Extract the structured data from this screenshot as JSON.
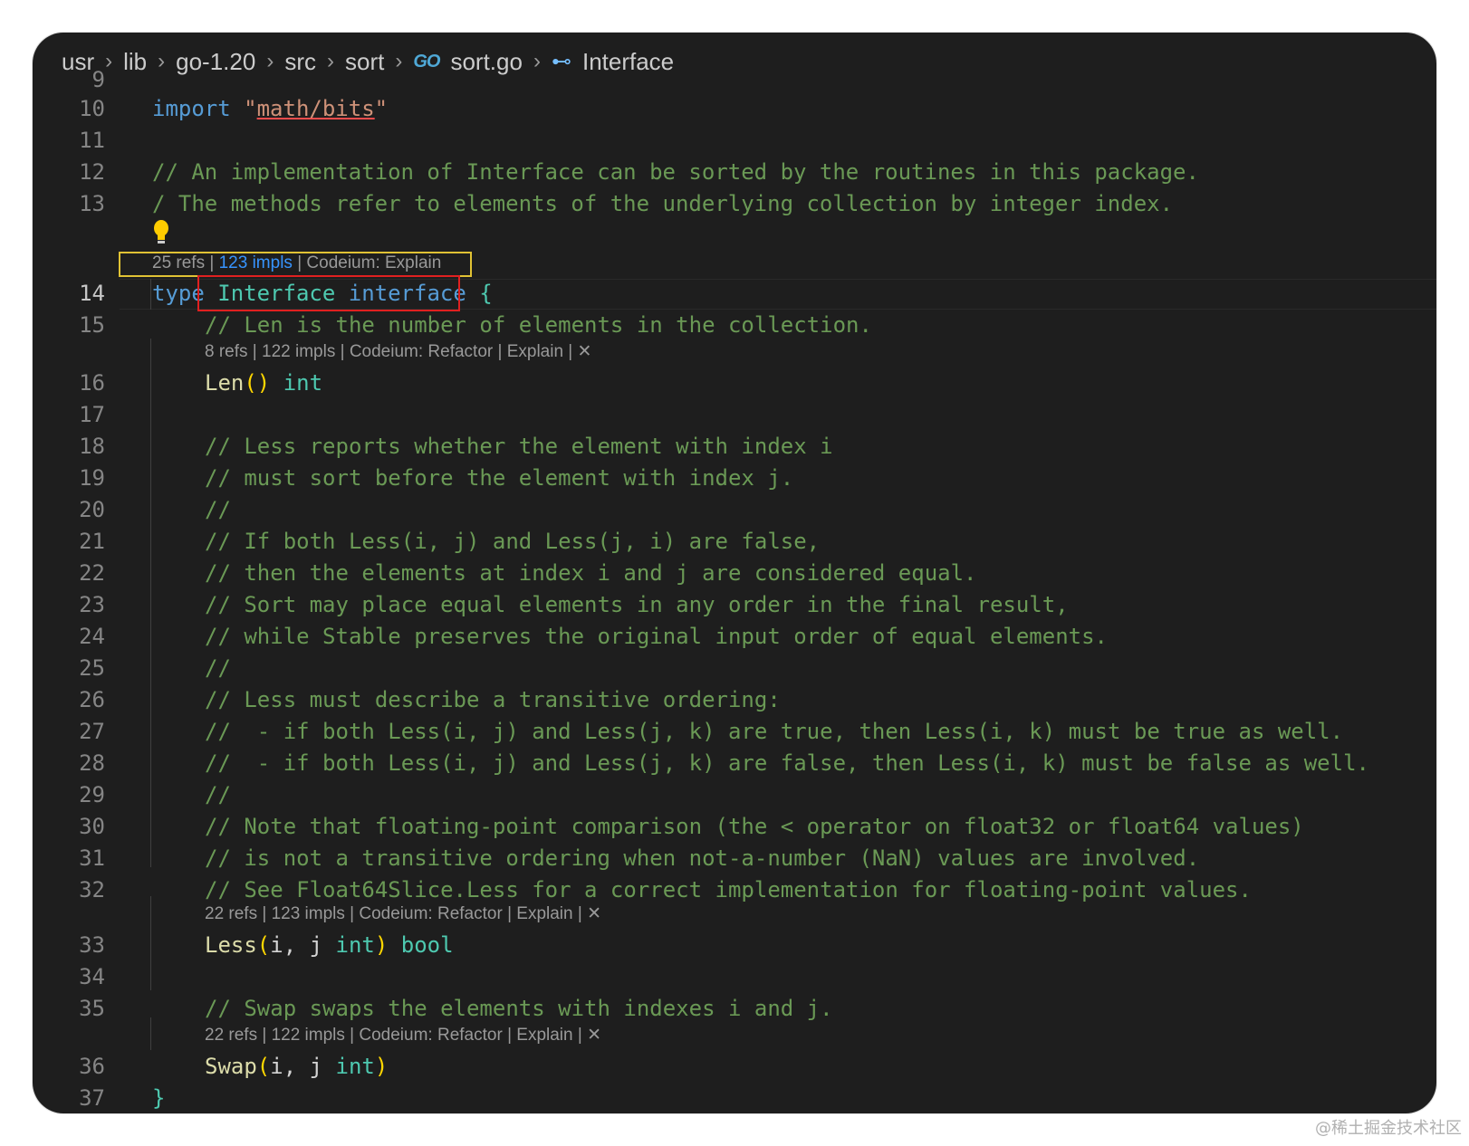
{
  "breadcrumb": {
    "items": [
      "usr",
      "lib",
      "go-1.20",
      "src",
      "sort",
      "sort.go",
      "Interface"
    ],
    "go_icon": "GO",
    "separator": ">"
  },
  "lenses": {
    "l14": "25 refs | ",
    "l14_link": "123 impls",
    "l14_rest": " | Codeium: Explain",
    "l16": "8 refs | 122 impls | Codeium: Refactor | Explain | ✕",
    "l33": "22 refs | 123 impls | Codeium: Refactor | Explain | ✕",
    "l36": "22 refs | 122 impls | Codeium: Refactor | Explain | ✕"
  },
  "code": {
    "l9": "9",
    "l10_kw": "import",
    "l10_q1": "\"",
    "l10_str": "math/bits",
    "l10_q2": "\"",
    "l12": "// An implementation of Interface can be sorted by the routines in this package.",
    "l13_a": "/",
    "l13_b": " The methods refer to elements of the underlying collection by integer index.",
    "l14_kw": "type",
    "l14_name": "Interface",
    "l14_kw2": "interface",
    "l14_brace": "{",
    "l15": "// Len is the number of elements in the collection.",
    "l16_fn": "Len",
    "l16_paren": "()",
    "l16_type": "int",
    "l18": "// Less reports whether the element with index i",
    "l19": "// must sort before the element with index j.",
    "l20": "//",
    "l21": "// If both Less(i, j) and Less(j, i) are false,",
    "l22": "// then the elements at index i and j are considered equal.",
    "l23": "// Sort may place equal elements in any order in the final result,",
    "l24": "// while Stable preserves the original input order of equal elements.",
    "l25": "//",
    "l26": "// Less must describe a transitive ordering:",
    "l27": "//  - if both Less(i, j) and Less(j, k) are true, then Less(i, k) must be true as well.",
    "l28": "//  - if both Less(i, j) and Less(j, k) are false, then Less(i, k) must be false as well.",
    "l29": "//",
    "l30": "// Note that floating-point comparison (the < operator on float32 or float64 values)",
    "l31": "// is not a transitive ordering when not-a-number (NaN) values are involved.",
    "l32": "// See Float64Slice.Less for a correct implementation for floating-point values.",
    "l33_fn": "Less",
    "l33_p1": "(",
    "l33_args": "i, j ",
    "l33_type": "int",
    "l33_p2": ")",
    "l33_ret": "bool",
    "l35": "// Swap swaps the elements with indexes i and j.",
    "l36_fn": "Swap",
    "l36_p1": "(",
    "l36_args": "i, j ",
    "l36_type": "int",
    "l36_p2": ")",
    "l37": "}"
  },
  "line_numbers": [
    "10",
    "11",
    "12",
    "13",
    "14",
    "15",
    "16",
    "17",
    "18",
    "19",
    "20",
    "21",
    "22",
    "23",
    "24",
    "25",
    "26",
    "27",
    "28",
    "29",
    "30",
    "31",
    "32",
    "33",
    "34",
    "35",
    "36",
    "37"
  ],
  "watermark": "@稀土掘金技术社区",
  "colors": {
    "keyword": "#569cd6",
    "string": "#ce9178",
    "comment": "#6a9955",
    "type": "#4ec9b0",
    "function": "#dcdcaa",
    "highlight_yellow": "#e0c234",
    "highlight_red": "#e02020"
  }
}
